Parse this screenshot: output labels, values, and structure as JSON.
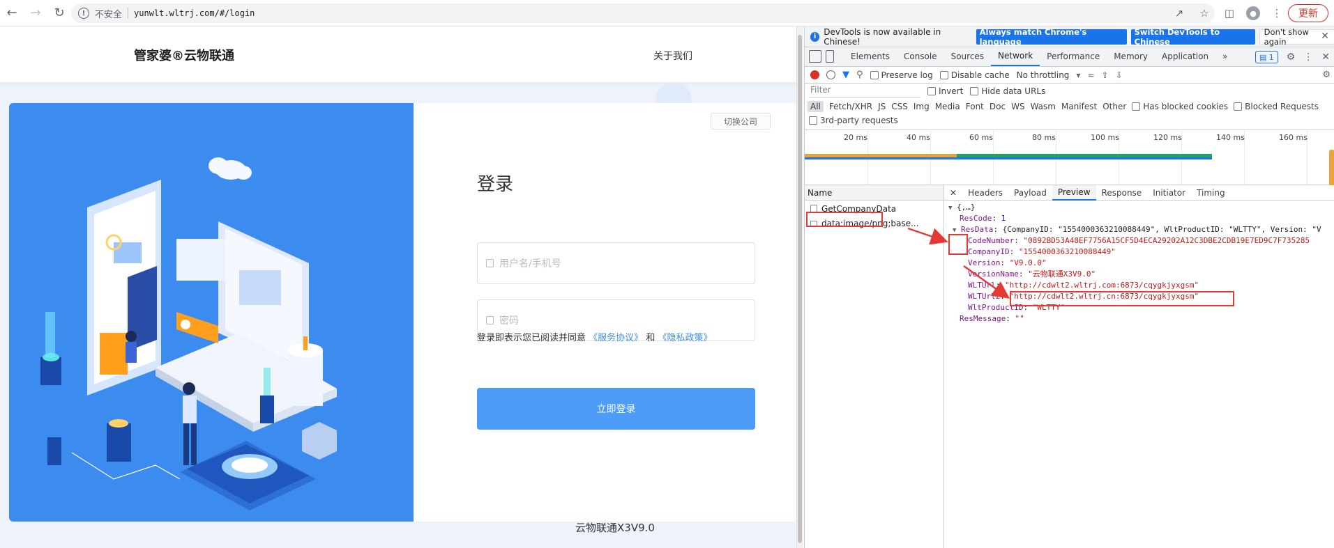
{
  "browser": {
    "insecure_label": "不安全",
    "url": "yunwlt.wltrj.com/#/login",
    "update_label": "更新"
  },
  "site": {
    "logo": "管家婆®云物联通",
    "about": "关于我们",
    "switch_company": "切换公司",
    "login_title": "登录",
    "username_placeholder": "用户名/手机号",
    "password_placeholder": "密码",
    "agree_prefix": "登录即表示您已阅读并同意",
    "service_link": "《服务协议》",
    "and": "和",
    "privacy_link": "《隐私政策》",
    "login_button": "立即登录",
    "version": "云物联通X3V9.0"
  },
  "devtools": {
    "info_text": "DevTools is now available in Chinese!",
    "btn_match": "Always match Chrome's language",
    "btn_switch": "Switch DevTools to Chinese",
    "btn_dont": "Don't show again",
    "tabs": [
      "Elements",
      "Console",
      "Sources",
      "Network",
      "Performance",
      "Memory",
      "Application"
    ],
    "more_tabs": "»",
    "issues_count": "1",
    "preserve_log": "Preserve log",
    "disable_cache": "Disable cache",
    "throttling": "No throttling",
    "filter_placeholder": "Filter",
    "invert": "Invert",
    "hide_data_urls": "Hide data URLs",
    "types": [
      "All",
      "Fetch/XHR",
      "JS",
      "CSS",
      "Img",
      "Media",
      "Font",
      "Doc",
      "WS",
      "Wasm",
      "Manifest",
      "Other"
    ],
    "has_blocked_cookies": "Has blocked cookies",
    "blocked_requests": "Blocked Requests",
    "third_party": "3rd-party requests",
    "timeline_ticks": [
      "20 ms",
      "40 ms",
      "60 ms",
      "80 ms",
      "100 ms",
      "120 ms",
      "140 ms",
      "160 ms"
    ],
    "name_header": "Name",
    "requests": [
      "GetCompanyData",
      "data:image/png;base..."
    ],
    "preview_tabs": [
      "Headers",
      "Payload",
      "Preview",
      "Response",
      "Initiator",
      "Timing"
    ],
    "json": {
      "root": "{,…}",
      "rescode_key": "ResCode",
      "rescode_val": "1",
      "resdata_key": "ResData",
      "resdata_summary": "{CompanyID: \"1554000363210088449\", WltProductID: \"WLTTY\", Version: \"V",
      "codenumber_key": "CodeNumber",
      "codenumber_val": "\"0892BD53A48EF7756A15CF5D4ECA29202A12C3DBE2CDB19E7ED9C7F735285",
      "companyid_key": "CompanyID",
      "companyid_val": "\"1554000363210088449\"",
      "version_key": "Version",
      "version_val": "\"V9.0.0\"",
      "versionname_key": "VersionName",
      "versionname_val": "\"云物联通X3V9.0\"",
      "wlturl_key": "WLTUrl",
      "wlturl_val": "\"http://cdwlt2.wltrj.com:6873/cqygkjyxgsm\"",
      "wlturl2_key": "WLTUrl2",
      "wlturl2_val": "\"http://cdwlt2.wltrj.cn:6873/cqygkjyxgsm\"",
      "productid_key": "WltProductID",
      "productid_val": "\"WLTTY\"",
      "resmessage_key": "ResMessage",
      "resmessage_val": "\"\""
    }
  },
  "colors": {
    "accent_blue": "#3c8bef",
    "highlight_red": "#e53935",
    "devtools_blue": "#1a73e8"
  }
}
